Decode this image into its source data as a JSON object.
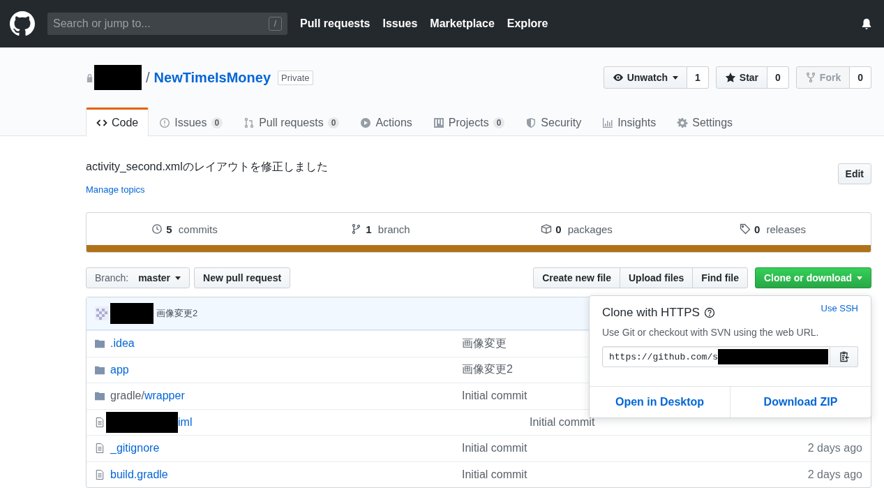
{
  "header": {
    "search_placeholder": "Search or jump to...",
    "slash_key": "/",
    "nav": [
      "Pull requests",
      "Issues",
      "Marketplace",
      "Explore"
    ]
  },
  "repo": {
    "separator": "/",
    "name": "NewTimeIsMoney",
    "visibility": "Private",
    "actions": [
      {
        "kind": "watch",
        "label": "Unwatch",
        "count": "1",
        "disabled": false
      },
      {
        "kind": "star",
        "label": "Star",
        "count": "0",
        "disabled": false
      },
      {
        "kind": "fork",
        "label": "Fork",
        "count": "0",
        "disabled": true
      }
    ]
  },
  "tabs": [
    {
      "kind": "code",
      "label": "Code",
      "selected": true
    },
    {
      "kind": "issues",
      "label": "Issues",
      "count": "0",
      "selected": false
    },
    {
      "kind": "pulls",
      "label": "Pull requests",
      "count": "0",
      "selected": false
    },
    {
      "kind": "actions",
      "label": "Actions",
      "selected": false
    },
    {
      "kind": "projects",
      "label": "Projects",
      "count": "0",
      "selected": false
    },
    {
      "kind": "security",
      "label": "Security",
      "selected": false
    },
    {
      "kind": "insights",
      "label": "Insights",
      "selected": false
    },
    {
      "kind": "settings",
      "label": "Settings",
      "selected": false
    }
  ],
  "description": "activity_second.xmlのレイアウトを修正しました",
  "edit_button": "Edit",
  "manage_topics": "Manage topics",
  "summary": [
    {
      "kind": "commits",
      "count": "5",
      "label": "commits"
    },
    {
      "kind": "branch",
      "count": "1",
      "label": "branch"
    },
    {
      "kind": "packages",
      "count": "0",
      "label": "packages"
    },
    {
      "kind": "releases",
      "count": "0",
      "label": "releases"
    }
  ],
  "branch_button": {
    "label": "Branch:",
    "value": "master"
  },
  "new_pr": "New pull request",
  "file_buttons": [
    "Create new file",
    "Upload files",
    "Find file"
  ],
  "clone_button": "Clone or download",
  "latest_commit": {
    "message": "画像変更2"
  },
  "files": [
    {
      "kind": "folder",
      "name": ".idea",
      "message": "画像変更"
    },
    {
      "kind": "folder",
      "name": "app",
      "message": "画像変更2"
    },
    {
      "kind": "folder",
      "prefix": "gradle/",
      "name": "wrapper",
      "message": "Initial commit"
    },
    {
      "kind": "file",
      "redacted": true,
      "name": "iml",
      "message": "Initial commit"
    },
    {
      "kind": "file",
      "name": "_gitignore",
      "message": "Initial commit",
      "age": "2 days ago"
    },
    {
      "kind": "file",
      "name": "build.gradle",
      "message": "Initial commit",
      "age": "2 days ago"
    }
  ],
  "clone_popup": {
    "title": "Clone with HTTPS",
    "use_ssh": "Use SSH",
    "hint": "Use Git or checkout with SVN using the web URL.",
    "url": "https://github.com/s",
    "actions": [
      "Open in Desktop",
      "Download ZIP"
    ]
  }
}
